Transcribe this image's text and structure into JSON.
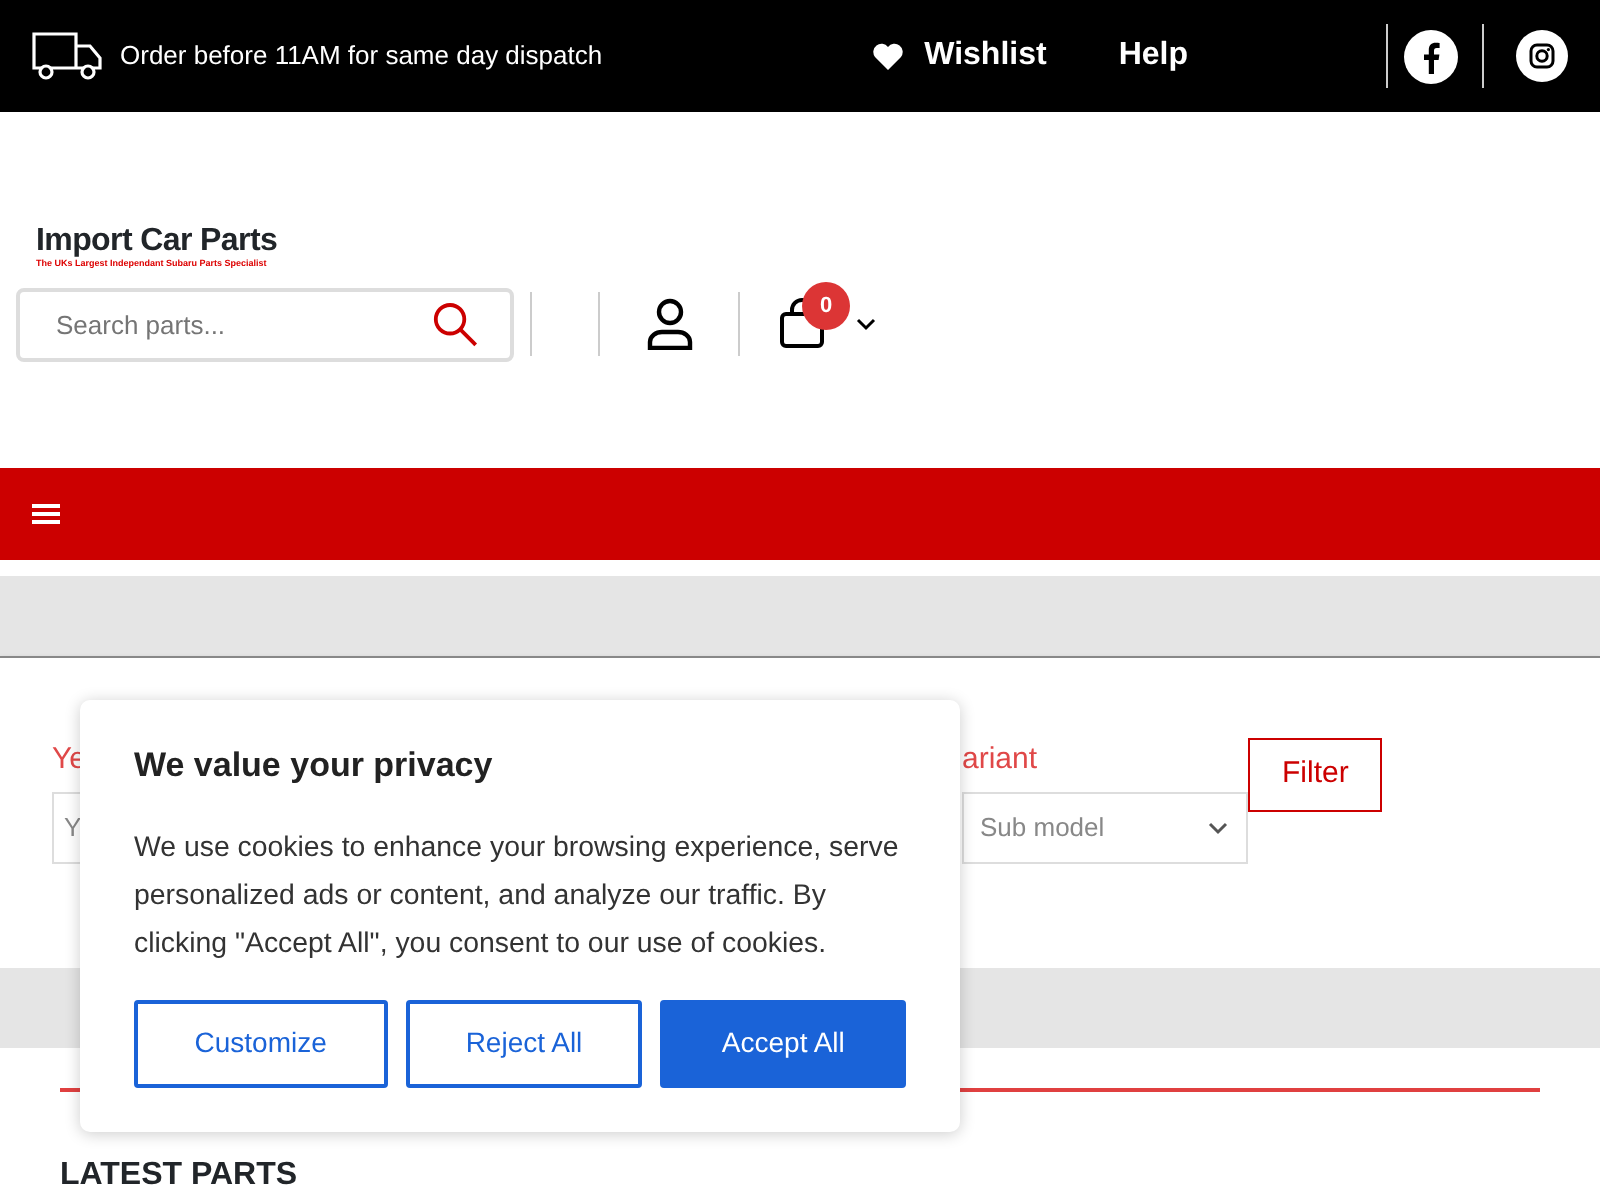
{
  "top_bar": {
    "dispatch_note": "Order before 11AM for same day dispatch",
    "links": [
      {
        "label": "Wishlist"
      },
      {
        "label": "Help"
      }
    ]
  },
  "header": {
    "logo_title": "Import Car Parts",
    "logo_tagline": "The UKs Largest Independant Subaru Parts Specialist",
    "search": {
      "placeholder": "Search parts..."
    },
    "cart_count": "0"
  },
  "filter": {
    "fields": [
      {
        "label": "Ye",
        "placeholder": "Y"
      },
      {
        "label": "ariant",
        "placeholder": "Sub model"
      }
    ],
    "button": "Filter"
  },
  "section_title": "LATEST PARTS",
  "cookie_banner": {
    "title": "We value your privacy",
    "text": "We use cookies to enhance your browsing experience, serve personalized ads or content, and analyze our traffic. By clicking \"Accept All\", you consent to our use of cookies.",
    "buttons": [
      {
        "label": "Customize",
        "kind": "outline"
      },
      {
        "label": "Reject All",
        "kind": "outline"
      },
      {
        "label": "Accept All",
        "kind": "primary"
      }
    ]
  }
}
